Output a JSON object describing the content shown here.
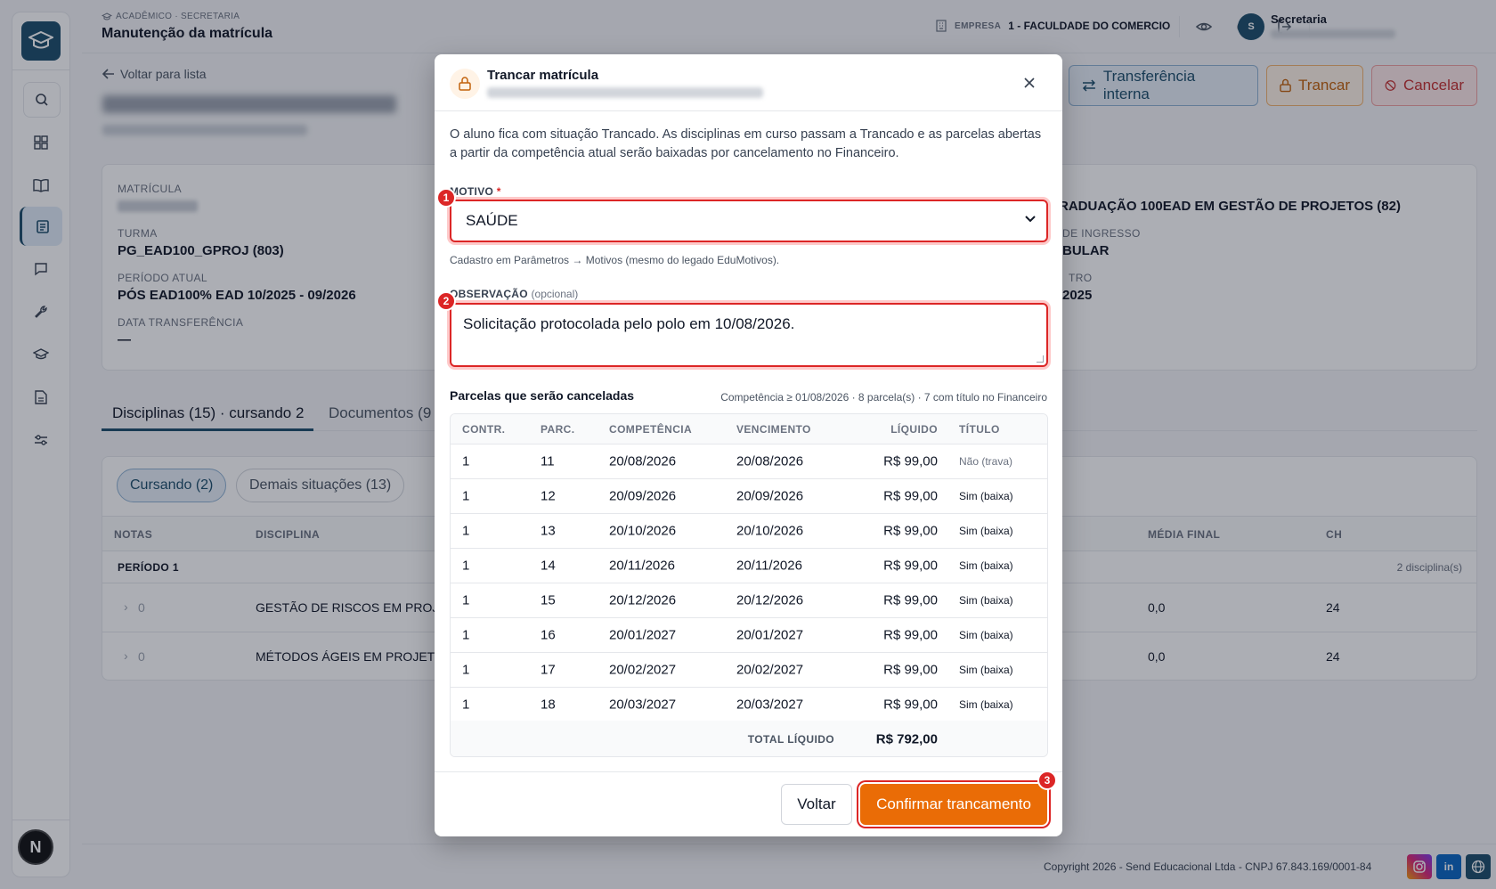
{
  "header": {
    "breadcrumb": "ACADÊMICO · SECRETARIA",
    "title": "Manutenção da matrícula",
    "empresa_label": "EMPRESA",
    "empresa_value": "1 - FACULDADE DO COMERCIO",
    "user_initial": "S",
    "user_name": "Secretaria"
  },
  "page": {
    "back_label": "Voltar para lista",
    "actions": {
      "transferencia": "Transferência interna",
      "trancar": "Trancar",
      "cancelar": "Cancelar"
    }
  },
  "info": {
    "matricula_label": "MATRÍCULA",
    "turma_label": "TURMA",
    "turma_value": "PG_EAD100_GPROJ (803)",
    "periodo_label": "PERÍODO ATUAL",
    "periodo_value": "PÓS EAD100% EAD 10/2025 - 09/2026",
    "transf_label": "DATA TRANSFERÊNCIA",
    "transf_value": "—",
    "curso_value": "RADUAÇÃO 100EAD EM GESTÃO DE PROJETOS (82)",
    "ingresso_label": "DE INGRESSO",
    "ingresso_value": "BULAR",
    "tro_label": "TRO",
    "tro_value": "2025"
  },
  "tabs": [
    "Disciplinas (15) · cursando 2",
    "Documentos (9"
  ],
  "disciplinas": {
    "chips": [
      "Cursando (2)",
      "Demais situações (13)"
    ],
    "headers": {
      "notas": "NOTAS",
      "disciplina": "DISCIPLINA",
      "media": "MÉDIA FINAL",
      "ch": "CH"
    },
    "period": "PERÍODO 1",
    "period_count": "2 disciplina(s)",
    "rows": [
      {
        "notas": "0",
        "disciplina": "GESTÃO DE RISCOS EM PROJE",
        "media": "0,0",
        "ch": "24"
      },
      {
        "notas": "0",
        "disciplina": "MÉTODOS ÁGEIS EM PROJETO",
        "media": "0,0",
        "ch": "24"
      }
    ]
  },
  "footer": {
    "copyright": "Copyright 2026 - Send Educacional Ltda - CNPJ 67.843.169/0001-84",
    "linkedin": "in"
  },
  "modal": {
    "title": "Trancar matrícula",
    "description": "O aluno fica com situação Trancado. As disciplinas em curso passam a Trancado e as parcelas abertas a partir da competência atual serão baixadas por cancelamento no Financeiro.",
    "motivo_label": "MOTIVO",
    "required_mark": "*",
    "motivo_value": "SAÚDE",
    "motivo_help": "Cadastro em Parâmetros → Motivos (mesmo do legado EduMotivos).",
    "obs_label": "OBSERVAÇÃO",
    "obs_optional": "(opcional)",
    "obs_value": "Solicitação protocolada pelo polo em 10/08/2026.",
    "parcelas_title": "Parcelas que serão canceladas",
    "parcelas_info": "Competência ≥ 01/08/2026 · 8 parcela(s) · 7 com título no Financeiro",
    "columns": {
      "contr": "CONTR.",
      "parc": "PARC.",
      "competencia": "COMPETÊNCIA",
      "vencimento": "VENCIMENTO",
      "liquido": "LÍQUIDO",
      "titulo": "TÍTULO"
    },
    "rows": [
      {
        "contr": "1",
        "parc": "11",
        "competencia": "20/08/2026",
        "vencimento": "20/08/2026",
        "liquido": "R$ 99,00",
        "titulo": "Não (trava)"
      },
      {
        "contr": "1",
        "parc": "12",
        "competencia": "20/09/2026",
        "vencimento": "20/09/2026",
        "liquido": "R$ 99,00",
        "titulo": "Sim (baixa)"
      },
      {
        "contr": "1",
        "parc": "13",
        "competencia": "20/10/2026",
        "vencimento": "20/10/2026",
        "liquido": "R$ 99,00",
        "titulo": "Sim (baixa)"
      },
      {
        "contr": "1",
        "parc": "14",
        "competencia": "20/11/2026",
        "vencimento": "20/11/2026",
        "liquido": "R$ 99,00",
        "titulo": "Sim (baixa)"
      },
      {
        "contr": "1",
        "parc": "15",
        "competencia": "20/12/2026",
        "vencimento": "20/12/2026",
        "liquido": "R$ 99,00",
        "titulo": "Sim (baixa)"
      },
      {
        "contr": "1",
        "parc": "16",
        "competencia": "20/01/2027",
        "vencimento": "20/01/2027",
        "liquido": "R$ 99,00",
        "titulo": "Sim (baixa)"
      },
      {
        "contr": "1",
        "parc": "17",
        "competencia": "20/02/2027",
        "vencimento": "20/02/2027",
        "liquido": "R$ 99,00",
        "titulo": "Sim (baixa)"
      },
      {
        "contr": "1",
        "parc": "18",
        "competencia": "20/03/2027",
        "vencimento": "20/03/2027",
        "liquido": "R$ 99,00",
        "titulo": "Sim (baixa)"
      }
    ],
    "total_label": "TOTAL LÍQUIDO",
    "total_value": "R$ 792,00",
    "btn_voltar": "Voltar",
    "btn_confirm": "Confirmar trancamento",
    "badges": [
      "1",
      "2",
      "3"
    ]
  },
  "colors": {
    "primary": "#1d4e6b",
    "accent": "#ea6c06",
    "danger": "#dc2626"
  }
}
